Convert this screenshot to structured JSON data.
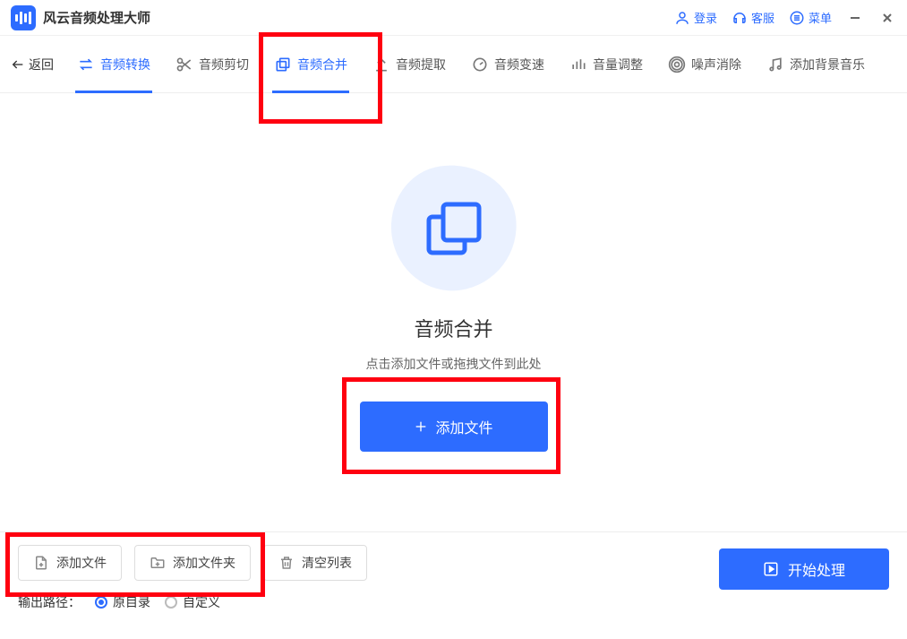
{
  "app": {
    "title": "风云音频处理大师"
  },
  "titlebar": {
    "login": "登录",
    "support": "客服",
    "menu": "菜单"
  },
  "nav": {
    "back": "返回",
    "items": [
      {
        "label": "音频转换",
        "icon": "convert-icon"
      },
      {
        "label": "音频剪切",
        "icon": "cut-icon"
      },
      {
        "label": "音频合并",
        "icon": "merge-icon"
      },
      {
        "label": "音频提取",
        "icon": "extract-icon"
      },
      {
        "label": "音频变速",
        "icon": "speed-icon"
      },
      {
        "label": "音量调整",
        "icon": "volume-icon"
      },
      {
        "label": "噪声消除",
        "icon": "denoise-icon"
      },
      {
        "label": "添加背景音乐",
        "icon": "bgm-icon"
      }
    ]
  },
  "main": {
    "title": "音频合并",
    "subtitle": "点击添加文件或拖拽文件到此处",
    "add_button": "添加文件"
  },
  "bottom": {
    "add_file": "添加文件",
    "add_folder": "添加文件夹",
    "clear_list": "清空列表",
    "output_label": "输出路径：",
    "radio_original": "原目录",
    "radio_custom": "自定义",
    "start": "开始处理"
  }
}
